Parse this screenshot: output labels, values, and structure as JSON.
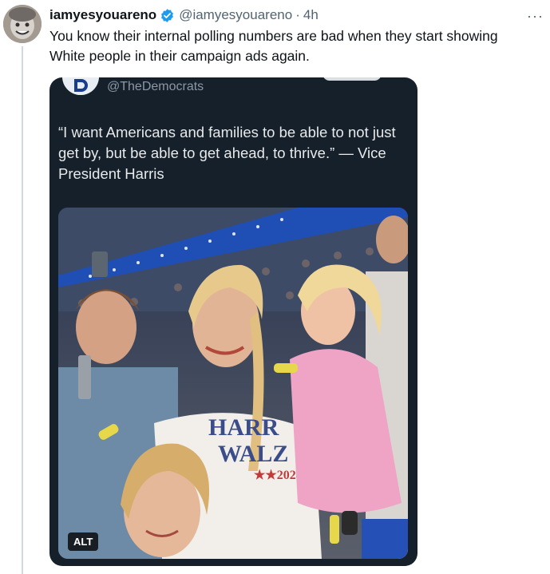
{
  "post": {
    "author_name": "iamyesyouareno",
    "author_handle": "@iamyesyouareno",
    "separator": "·",
    "timestamp": "4h",
    "text": "You know their internal polling numbers are bad when they start showing White people in their campaign ads again."
  },
  "quoted": {
    "handle": "@TheDemocrats",
    "text": "“I want Americans and families to be able to not just get by, but be able to get ahead, to thrive.” — Vice President Harris",
    "photo_alt_badge": "ALT",
    "shirt_text": [
      "HARR",
      "WALZ",
      "★★2024"
    ]
  },
  "icons": {
    "verified": "verified-badge-icon",
    "more": "more-options-icon",
    "logo": "democrats-logo-icon"
  },
  "colors": {
    "verified": "#1d9bf0",
    "card_bg": "#15202b",
    "secondary_text": "#536471"
  }
}
